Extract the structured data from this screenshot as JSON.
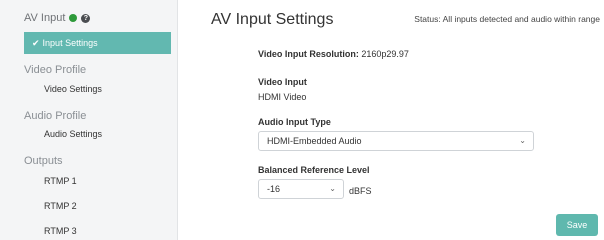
{
  "sidebar": {
    "av_input_label": "AV Input",
    "active_item": "Input Settings",
    "sections": [
      {
        "label": "Video Profile",
        "items": [
          "Video Settings"
        ]
      },
      {
        "label": "Audio Profile",
        "items": [
          "Audio Settings"
        ]
      },
      {
        "label": "Outputs",
        "items": [
          "RTMP 1",
          "RTMP 2",
          "RTMP 3"
        ]
      }
    ]
  },
  "header": {
    "title": "AV Input Settings",
    "status": "Status: All inputs detected and audio within range"
  },
  "form": {
    "resolution_label": "Video Input Resolution:",
    "resolution_value": "2160p29.97",
    "video_input_label": "Video Input",
    "video_input_value": "HDMI Video",
    "audio_input_type_label": "Audio Input Type",
    "audio_input_type_selected": "HDMI-Embedded Audio",
    "balanced_ref_label": "Balanced Reference Level",
    "balanced_ref_selected": "-16",
    "balanced_ref_unit": "dBFS"
  },
  "actions": {
    "save_label": "Save"
  },
  "colors": {
    "accent": "#5fb8ae",
    "status_ok": "#2e9a3a"
  }
}
